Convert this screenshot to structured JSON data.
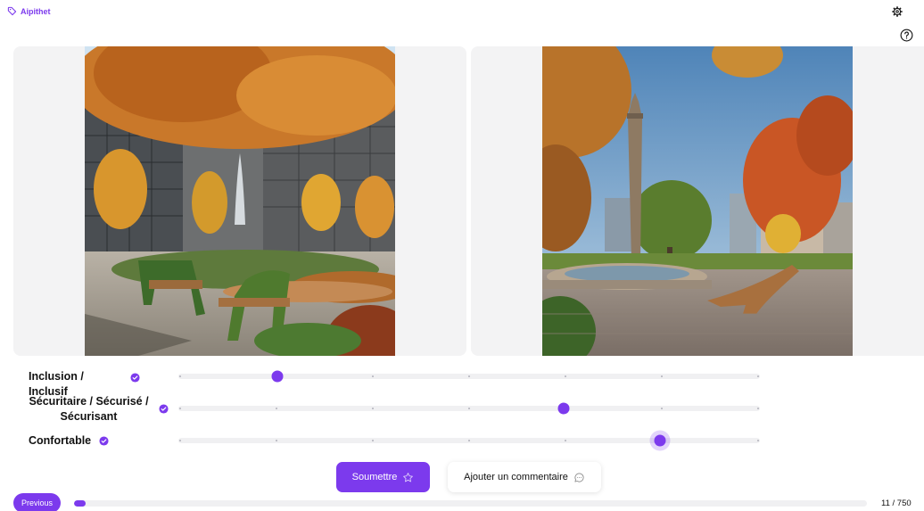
{
  "app": {
    "name": "Aipithet"
  },
  "colors": {
    "accent": "#7c3aed",
    "panel_bg": "#f3f3f4",
    "track": "#f0f0f2"
  },
  "header": {
    "settings_icon": "gear-icon",
    "help_icon": "question-circle-icon"
  },
  "images": [
    {
      "id": "left",
      "scene": "autumn plaza with wooden lounge chairs and fountain"
    },
    {
      "id": "right",
      "scene": "plaza with stone tower, fountain and wooden lounger"
    }
  ],
  "ratings": [
    {
      "label": "Inclusion / Inclusif",
      "value": 0.171,
      "active": false
    },
    {
      "label": "Sécuritaire / Sécurisé / Sécurisant",
      "value": 0.663,
      "active": false
    },
    {
      "label": "Confortable",
      "value": 0.828,
      "active": true
    }
  ],
  "slider": {
    "ticks": 7
  },
  "actions": {
    "submit_label": "Soumettre",
    "comment_label": "Ajouter un commentaire"
  },
  "footer": {
    "previous_label": "Previous",
    "counter": "11 / 750",
    "progress_current": 11,
    "progress_total": 750
  }
}
